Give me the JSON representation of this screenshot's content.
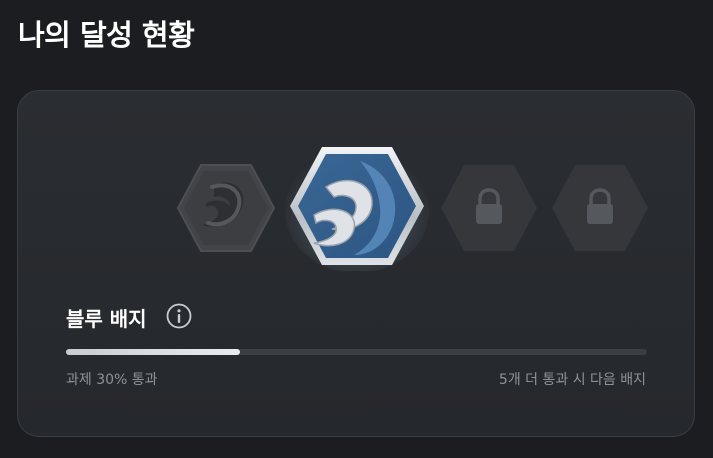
{
  "page_title": "나의 달성 현황",
  "badge_card": {
    "badges": [
      {
        "state": "earned",
        "icon": "wave-emblem-icon",
        "color": "#4a4c50"
      },
      {
        "state": "current",
        "icon": "wave-emblem-icon",
        "color": "#3d6fa6"
      },
      {
        "state": "locked",
        "icon": "lock-icon",
        "color": "#35373b"
      },
      {
        "state": "locked",
        "icon": "lock-icon",
        "color": "#35373b"
      }
    ],
    "badge_name": "블루 배지",
    "info_icon": "info-icon",
    "progress": {
      "fraction": 0.3,
      "left_text": "과제 30% 통과",
      "right_text": "5개 더 통과 시 다음 배지"
    }
  }
}
